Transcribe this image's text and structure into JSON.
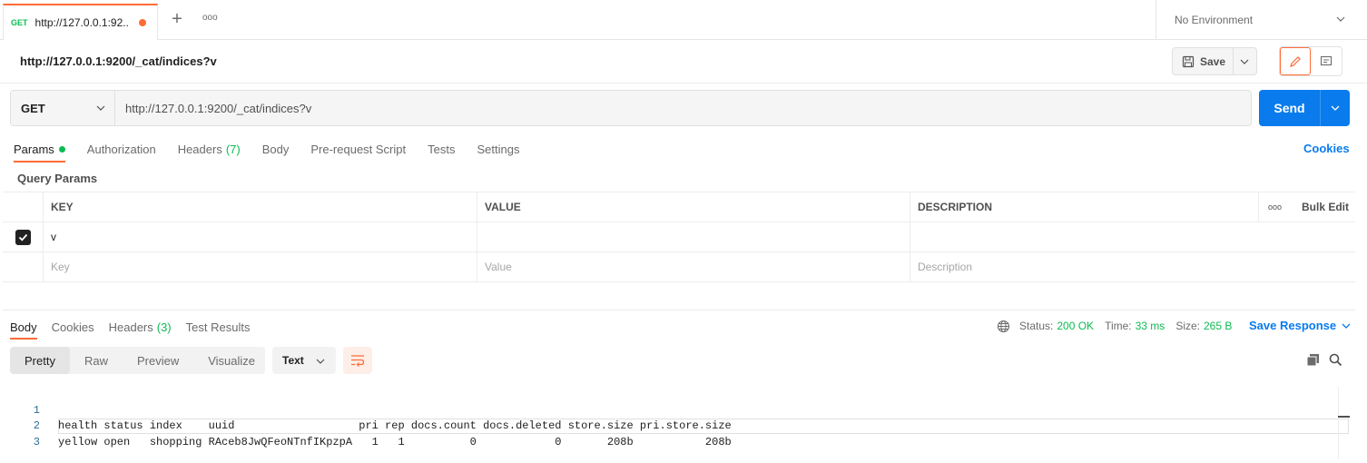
{
  "tabs": [
    {
      "method": "GET",
      "title": "http://127.0.0.1:92..."
    }
  ],
  "icons": {
    "add_tab": "plus-icon",
    "more_tabs": "more-horizontal-icon",
    "env_dropdown": "chevron-down-icon",
    "save": "save-icon",
    "edit": "pencil-icon",
    "comments": "comment-icon",
    "globe": "globe-icon",
    "wrap": "wrap-lines-icon",
    "copy": "copy-icon",
    "search": "search-icon"
  },
  "environment": {
    "label": "No Environment"
  },
  "request": {
    "title": "http://127.0.0.1:9200/_cat/indices?v",
    "save_label": "Save",
    "method": "GET",
    "url": "http://127.0.0.1:9200/_cat/indices?v",
    "send_label": "Send"
  },
  "request_tabs": {
    "params": "Params",
    "authorization": "Authorization",
    "headers": "Headers",
    "headers_count": "(7)",
    "body": "Body",
    "prerequest": "Pre-request Script",
    "tests": "Tests",
    "settings": "Settings",
    "cookies": "Cookies"
  },
  "query_params": {
    "title": "Query Params",
    "columns": {
      "key": "KEY",
      "value": "VALUE",
      "description": "DESCRIPTION",
      "bulk_edit": "Bulk Edit"
    },
    "rows": [
      {
        "key": "v",
        "value": "",
        "description": "",
        "checked": true
      }
    ],
    "placeholders": {
      "key": "Key",
      "value": "Value",
      "description": "Description"
    }
  },
  "response_tabs": {
    "body": "Body",
    "cookies": "Cookies",
    "headers": "Headers",
    "headers_count": "(3)",
    "test_results": "Test Results"
  },
  "response_status": {
    "status_label": "Status:",
    "status_value": "200 OK",
    "time_label": "Time:",
    "time_value": "33 ms",
    "size_label": "Size:",
    "size_value": "265 B",
    "save_response": "Save Response"
  },
  "view_modes": [
    "Pretty",
    "Raw",
    "Preview",
    "Visualize"
  ],
  "format": "Text",
  "code_lines": [
    {
      "num": "1",
      "text": "health status index    uuid                   pri rep docs.count docs.deleted store.size pri.store.size"
    },
    {
      "num": "2",
      "text": "yellow open   shopping RAceb8JwQFeoNTnfIKpzpA   1   1          0            0       208b           208b"
    },
    {
      "num": "3",
      "text": ""
    }
  ],
  "colors": {
    "accent": "#ff6c37",
    "primary": "#097bed",
    "success": "#0cbb52"
  }
}
